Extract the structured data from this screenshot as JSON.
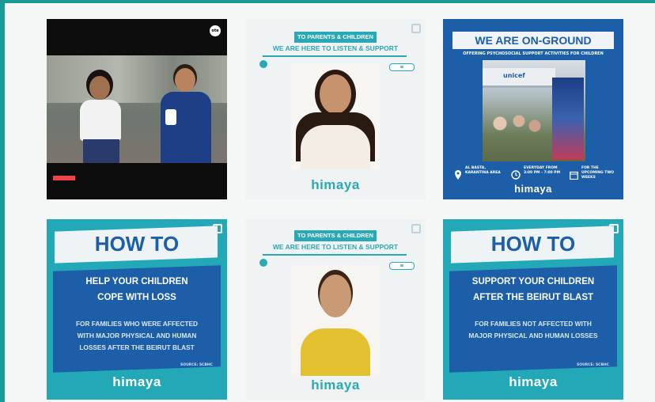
{
  "tile_video": {
    "channel_logo": "ote"
  },
  "tile_parents_1": {
    "banner": "TO PARENTS & CHILDREN",
    "subtitle": "WE ARE HERE TO LISTEN & SUPPORT",
    "brand": "himaya"
  },
  "tile_onground": {
    "title": "WE ARE ON-GROUND",
    "subtitle": "OFFERING PSYCHOSOCIAL SUPPORT ACTIVITIES FOR CHILDREN",
    "sign": "unicef",
    "location": "AL BASTA, KARANTINA AREA",
    "hours": "EVERYDAY FROM 3:00 PM - 7:00 PM",
    "duration": "FOR THE UPCOMING TWO WEEKS",
    "brand": "himaya"
  },
  "tile_howto_loss": {
    "heading": "HOW TO",
    "headline_line1": "HELP YOUR CHILDREN",
    "headline_line2": "COPE WITH LOSS",
    "desc_line1": "FOR FAMILIES WHO WERE AFFECTED",
    "desc_line2": "WITH MAJOR PHYSICAL AND HUMAN",
    "desc_line3": "LOSSES AFTER THE BEIRUT BLAST",
    "source": "SOURCE: SCBHC",
    "brand": "himaya"
  },
  "tile_parents_2": {
    "banner": "TO PARENTS & CHILDREN",
    "subtitle": "WE ARE HERE TO LISTEN & SUPPORT",
    "brand": "himaya"
  },
  "tile_howto_blast": {
    "heading": "HOW TO",
    "headline_line1": "SUPPORT YOUR CHILDREN",
    "headline_line2": "AFTER THE BEIRUT BLAST",
    "desc_line1": "FOR FAMILIES NOT AFFECTED WITH",
    "desc_line2": "MAJOR PHYSICAL AND HUMAN LOSSES",
    "source": "SOURCE: SCBHC",
    "brand": "himaya"
  },
  "colors": {
    "teal": "#29a9b5",
    "blue": "#1c5ea8",
    "frame": "#1a9a94"
  }
}
